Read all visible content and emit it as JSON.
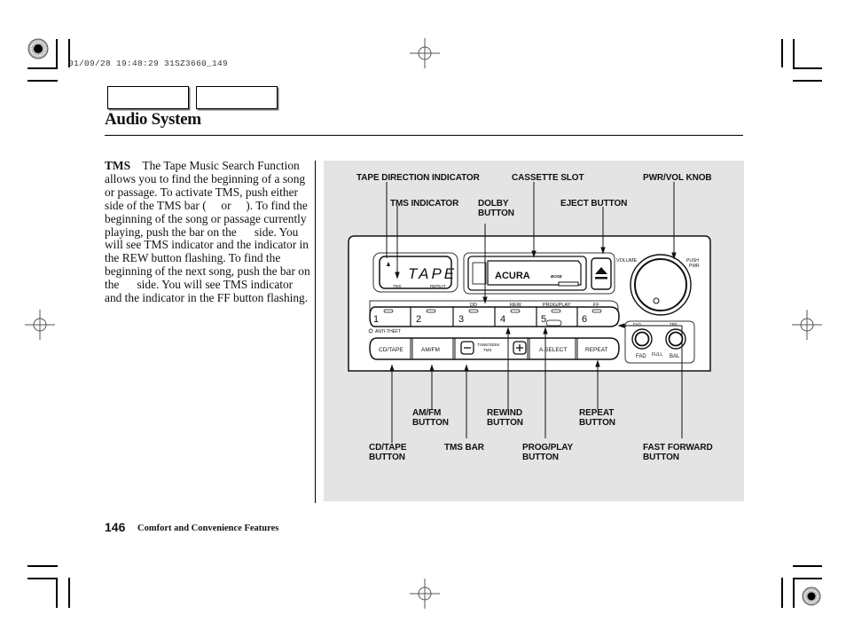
{
  "print_stamp": "01/09/28 19:48:29 31SZ3660_149",
  "header": {
    "tabs": [
      {
        "label": ""
      },
      {
        "label": ""
      }
    ],
    "title": "Audio System"
  },
  "body": {
    "lead": "TMS",
    "paragraph": "The Tape Music Search Function allows you to find the beginning of a song or passage. To activate TMS, push either side of the TMS bar (  or  ). To find the beginning of the song or passage currently playing, push the bar on the   side. You will see TMS indicator and the indicator in the REW button flashing. To find the beginning of the next song, push the bar on the   side. You will see TMS indicator and the indicator in the FF button flashing."
  },
  "figure": {
    "callouts": {
      "tape_direction_indicator": "TAPE DIRECTION INDICATOR",
      "cassette_slot": "CASSETTE SLOT",
      "pwr_vol_knob": "PWR/VOL KNOB",
      "tms_indicator": "TMS INDICATOR",
      "dolby_button": [
        "DOLBY",
        "BUTTON"
      ],
      "eject_button": "EJECT BUTTON",
      "am_fm_button": [
        "AM/FM",
        "BUTTON"
      ],
      "rewind_button": [
        "REWIND",
        "BUTTON"
      ],
      "repeat_button": [
        "REPEAT",
        "BUTTON"
      ],
      "cd_tape_button": [
        "CD/TAPE",
        "BUTTON"
      ],
      "tms_bar": "TMS BAR",
      "prog_play_button": [
        "PROG/PLAY",
        "BUTTON"
      ],
      "fast_forward_button": [
        "FAST FORWARD",
        "BUTTON"
      ]
    },
    "unit": {
      "display_text": "TAPE",
      "display_tms": "TMS",
      "display_repeat": "REPEAT",
      "brand": "ACURA",
      "audio_brand": "BOSE",
      "presets": [
        "1",
        "2",
        "3",
        "4",
        "5",
        "6"
      ],
      "preset_captions": {
        "dolby": "DD",
        "rew": "REW",
        "prog_play": "PROG/PLAY",
        "ff": "FF"
      },
      "anti_theft": "ANTI-THEFT",
      "buttons": {
        "cd_tape": "CD/TAPE",
        "am_fm": "AM/FM",
        "tune_seek": "TUNE/SEEK",
        "tms": "TMS",
        "a_select": "A.SELECT",
        "repeat": "REPEAT"
      },
      "volume": "VOLUME",
      "push_pwr": [
        "PUSH",
        "PWR"
      ],
      "fad": "FAD",
      "full": "FULL",
      "bal": "BAL",
      "fad_top": "FAD",
      "tre": "TRE"
    }
  },
  "footer": {
    "page_number": "146",
    "section": "Comfort and Convenience Features"
  }
}
